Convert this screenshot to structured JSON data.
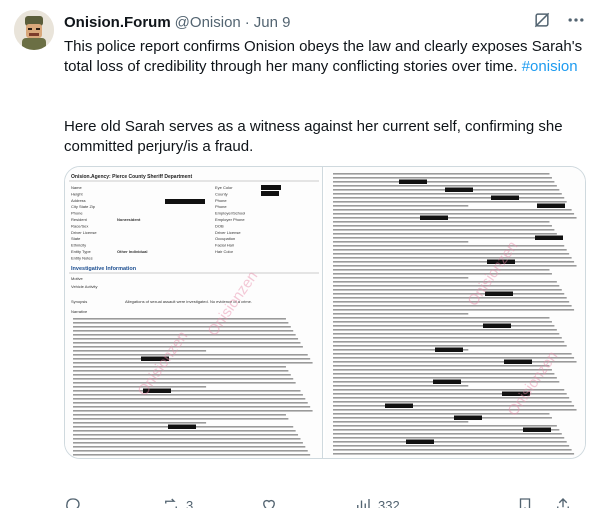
{
  "post": {
    "display_name": "Onision.Forum",
    "handle": "@Onision",
    "separator": "·",
    "date": "Jun 9",
    "paragraph1_text": "This police report confirms Onision obeys the law and clearly exposes Sarah's total loss of credibility through her many conflicting stories over time.",
    "paragraph1_hashtag": "#onision",
    "paragraph2": "Here old Sarah serves as a witness against her current self, confirming she committed perjury/is a fraud."
  },
  "document_left": {
    "section_title": "Investigative Information",
    "row_labels": [
      "Name",
      "Height",
      "Address",
      "City State Zip",
      "Phone",
      "Resident",
      "Race/Sex",
      "Driver License",
      "State",
      "Ethnicity",
      "Entity Type",
      "Entity Notes"
    ],
    "row_values": [
      "",
      "",
      "",
      "",
      "",
      "Nonresident",
      "",
      "",
      "",
      "",
      "Other Individual",
      ""
    ],
    "right_labels": [
      "Eye Color",
      "County",
      "Phone",
      "Phone",
      "Employer/School",
      "Employer Phone",
      "DOB",
      "Driver License",
      "Occupation",
      "Facial Hair",
      "Hair Color"
    ],
    "synopsis_label": "Synopsis",
    "synopsis_text": "Allegations of sexual assault were investigated. No evidence of a crime."
  },
  "document_right": {
    "heading": ""
  },
  "watermark": "Onisionzen",
  "actions": {
    "reply_count": "",
    "repost_count": "3",
    "like_count": "",
    "view_count": "332"
  },
  "icons": {
    "avatar": "avatar",
    "slash": "no-grok-icon",
    "more": "more-icon",
    "reply": "reply-icon",
    "repost": "repost-icon",
    "like": "like-icon",
    "views": "views-icon",
    "bookmark": "bookmark-icon",
    "share": "share-icon"
  },
  "colors": {
    "text": "#0f1419",
    "muted": "#536471",
    "link": "#1d9bf0",
    "border": "#cfd9de",
    "redaction": "#111111",
    "watermark": "#e88aa8"
  }
}
